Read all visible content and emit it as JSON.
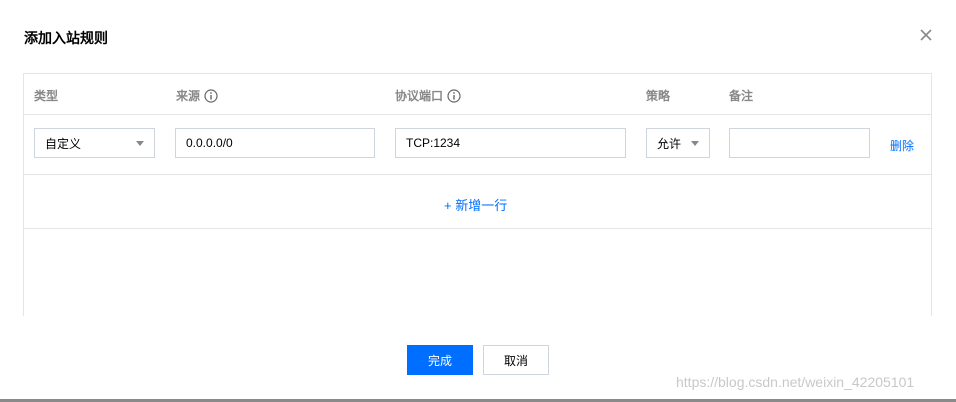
{
  "dialog": {
    "title": "添加入站规则",
    "close_icon": "close-icon"
  },
  "table": {
    "headers": {
      "type": "类型",
      "source": "来源",
      "port": "协议端口",
      "policy": "策略",
      "remark": "备注"
    },
    "info_icon": "info-icon",
    "rows": [
      {
        "type": "自定义",
        "source": "0.0.0.0/0",
        "port": "TCP:1234",
        "policy": "允许",
        "remark": "",
        "delete_label": "删除"
      }
    ],
    "add_row_label": "+ 新增一行"
  },
  "footer": {
    "confirm_label": "完成",
    "cancel_label": "取消"
  },
  "watermark": "https://blog.csdn.net/weixin_42205101",
  "colors": {
    "primary": "#006eff",
    "border": "#e5e5e5",
    "header_text": "#888888"
  }
}
